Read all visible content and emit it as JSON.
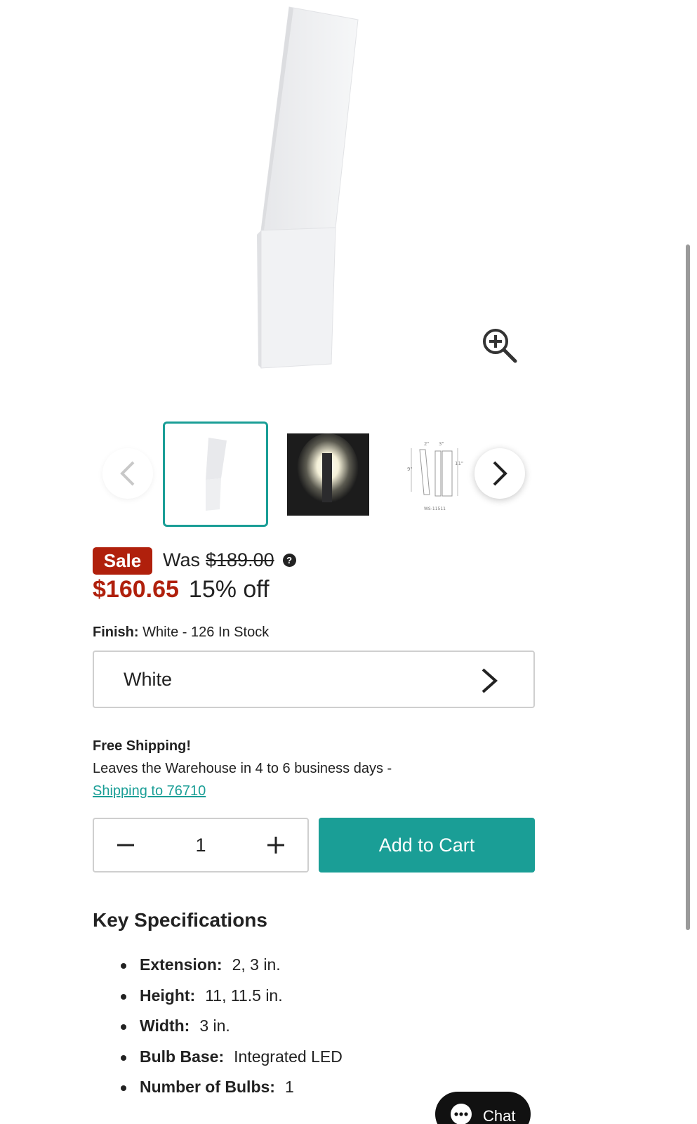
{
  "gallery": {
    "zoom_icon": "zoom-in-icon",
    "prev_icon": "chevron-left-icon",
    "next_icon": "chevron-right-icon",
    "thumbnails": [
      {
        "name": "white-sconce"
      },
      {
        "name": "lit-sconce"
      },
      {
        "name": "dimension-drawing",
        "label": "WS-11511",
        "dims": [
          "2\"",
          "3\"",
          "9\"",
          "11\""
        ]
      }
    ]
  },
  "pricing": {
    "sale_badge": "Sale",
    "was_label": "Was",
    "was_price": "$189.00",
    "help_icon": "?",
    "current_price": "$160.65",
    "percent_off": "15% off",
    "sale_color": "#b0200c"
  },
  "finish": {
    "label": "Finish:",
    "value": "White -",
    "stock": "126 In Stock",
    "selected": "White"
  },
  "shipping": {
    "title": "Free Shipping!",
    "text": "Leaves the Warehouse in 4 to 6 business days -",
    "link": "Shipping to 76710"
  },
  "cart": {
    "quantity": "1",
    "add_label": "Add to Cart",
    "accent_color": "#1a9e96"
  },
  "specs": {
    "title": "Key Specifications",
    "items": [
      {
        "label": "Extension:",
        "value": "2, 3 in."
      },
      {
        "label": "Height:",
        "value": "11, 11.5 in."
      },
      {
        "label": "Width:",
        "value": "3 in."
      },
      {
        "label": "Bulb Base:",
        "value": "Integrated LED"
      },
      {
        "label": "Number of Bulbs:",
        "value": "1"
      }
    ]
  },
  "chat": {
    "label": "Chat",
    "icon": "chat-bubble-icon"
  }
}
